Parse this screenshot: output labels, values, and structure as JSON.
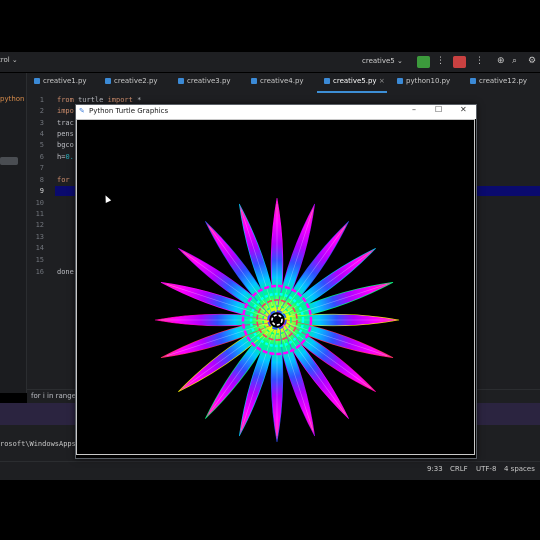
{
  "ide": {
    "vcs_label": "trol ⌄",
    "run_config": "creative5 ⌄",
    "tabs": [
      {
        "label": "creative1.py",
        "active": false
      },
      {
        "label": "creative2.py",
        "active": false
      },
      {
        "label": "creative3.py",
        "active": false
      },
      {
        "label": "creative4.py",
        "active": false
      },
      {
        "label": "creative5.py",
        "active": true,
        "close": "×"
      },
      {
        "label": "python10.py",
        "active": false
      },
      {
        "label": "creative12.py",
        "active": false
      }
    ],
    "sidebar_label": "python",
    "line_numbers": [
      "1",
      "2",
      "3",
      "4",
      "5",
      "6",
      "7",
      "8",
      "9",
      "10",
      "11",
      "12",
      "13",
      "14",
      "15",
      "16"
    ],
    "current_line": "9",
    "code": {
      "l1_a": "from",
      "l1_b": " turtle ",
      "l1_c": "import",
      "l1_d": " *",
      "l2": "impo",
      "l3": "trac",
      "l4": "pens",
      "l5": "bgco",
      "l6_a": "h=",
      "l6_b": "0.",
      "l8": "for",
      "l16": "done"
    },
    "breadcrumb": "for i in range",
    "terminal_path": "rosoft\\WindowsApps",
    "status": {
      "position": "9:33",
      "line_ending": "CRLF",
      "encoding": "UTF-8",
      "indent": "4 spaces"
    }
  },
  "turtle_window": {
    "title": "Python Turtle Graphics",
    "minimize": "–",
    "maximize": "☐",
    "close": "✕",
    "drawing": {
      "spikes": 20,
      "background": "#000000",
      "colors": [
        "#ff00ff",
        "#b000ff",
        "#3050ff",
        "#00c8ff",
        "#00ff80",
        "#ffff00",
        "#ff3060",
        "#ff00aa"
      ]
    }
  },
  "colors": {
    "ide_bg": "#1e1f22",
    "accent": "#3d8fd6",
    "run_green": "#3c9a3c",
    "stop_red": "#c94141",
    "current_line_bg": "#0a0a6e"
  }
}
